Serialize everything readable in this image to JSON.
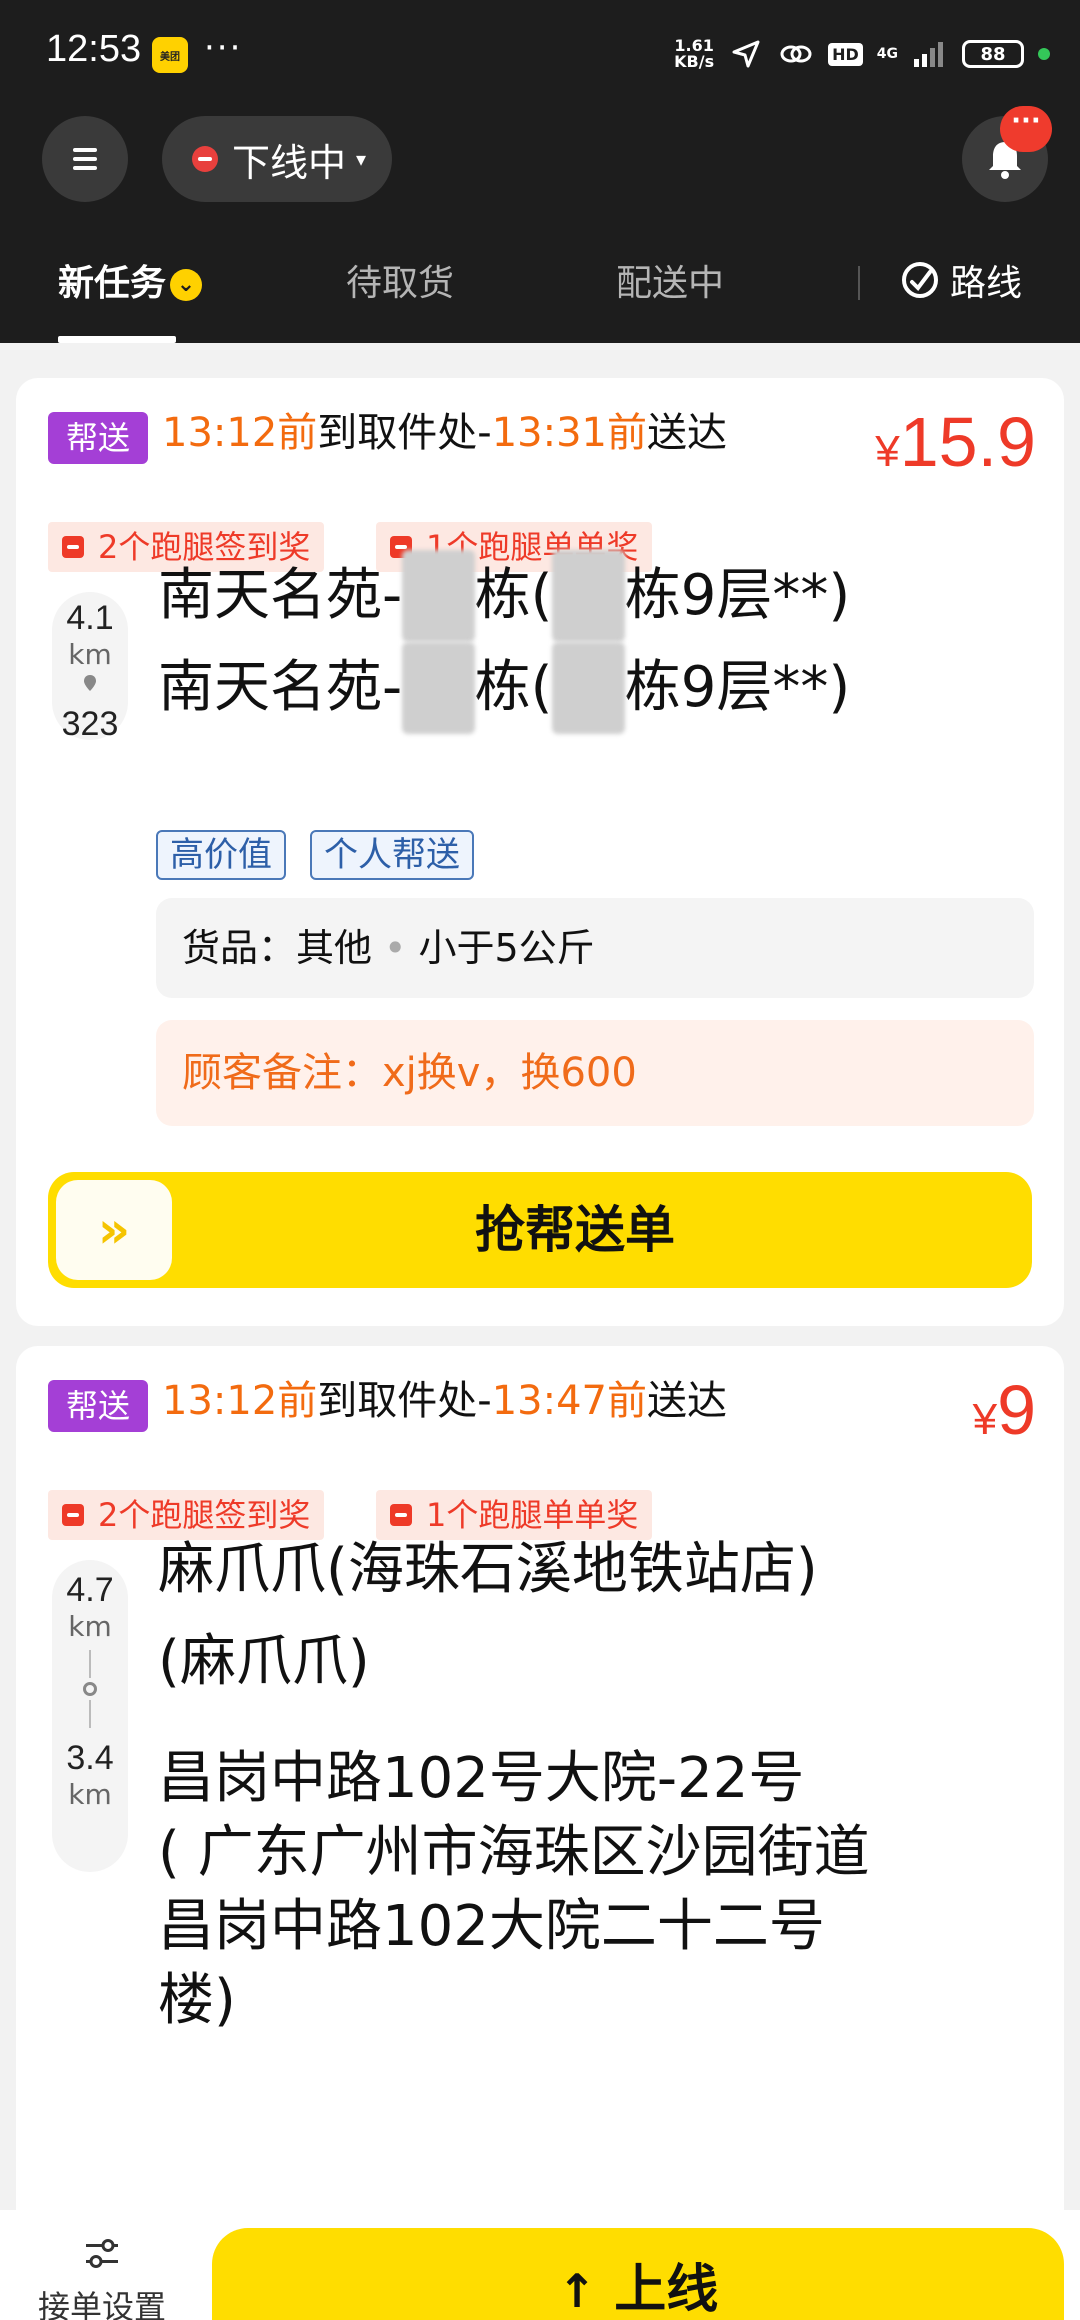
{
  "status_bar": {
    "time": "12:53",
    "app_badge": "美团",
    "more": "···",
    "speed_value": "1.61",
    "speed_unit": "KB/s",
    "hd": "HD",
    "network": "4G",
    "battery": "88"
  },
  "header": {
    "status_label": "下线中",
    "notification_badge": "···",
    "tabs": [
      {
        "label": "新任务"
      },
      {
        "label": "待取货"
      },
      {
        "label": "配送中"
      }
    ],
    "route_label": "路线"
  },
  "orders": [
    {
      "tag": "帮送",
      "pickup_time": "13:12前",
      "pickup_text": "到取件处-",
      "deliver_time": "13:31前",
      "deliver_text": "送达",
      "price_symbol": "¥",
      "price": "15.9",
      "rewards": [
        "2个跑腿签到奖",
        "1个跑腿单单奖"
      ],
      "pickup_distance": "4.1",
      "pickup_unit": "km",
      "deliver_distance": "323",
      "pickup_address_prefix": "南天名苑-",
      "pickup_address_suffix": "栋(",
      "pickup_address_tail": "栋9层**)",
      "deliver_address_prefix": "南天名苑-",
      "deliver_address_suffix": "栋(",
      "deliver_address_tail": "栋9层**)",
      "chips": [
        "高价值",
        "个人帮送"
      ],
      "goods_label": "货品：",
      "goods_type": "其他",
      "goods_weight": "小于5公斤",
      "note": "顾客备注：xj换v，换600",
      "grab_label": "抢帮送单",
      "grab_handle": "»"
    },
    {
      "tag": "帮送",
      "pickup_time": "13:12前",
      "pickup_text": "到取件处-",
      "deliver_time": "13:47前",
      "deliver_text": "送达",
      "price_symbol": "¥",
      "price": "9",
      "rewards": [
        "2个跑腿签到奖",
        "1个跑腿单单奖"
      ],
      "pickup_distance": "4.7",
      "pickup_unit": "km",
      "deliver_distance": "3.4",
      "deliver_unit": "km",
      "pickup_address_lines": [
        "麻爪爪(海珠石溪地铁站店)",
        "(麻爪爪)"
      ],
      "deliver_address_lines": [
        "昌岗中路102号大院-22号",
        "( 广东广州市海珠区沙园街道",
        "昌岗中路102大院二十二号",
        "楼)"
      ]
    }
  ],
  "bottom": {
    "settings_label": "接单设置",
    "online_label": "上线",
    "online_arrow": "↑"
  }
}
